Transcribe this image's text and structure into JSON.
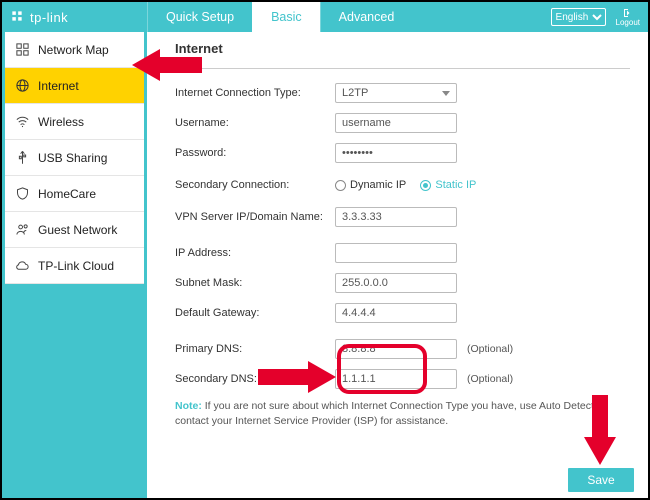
{
  "brand": "tp-link",
  "tabs": {
    "quick": "Quick Setup",
    "basic": "Basic",
    "advanced": "Advanced"
  },
  "lang": "English",
  "logout": "Logout",
  "sidebar": {
    "items": [
      {
        "label": "Network Map"
      },
      {
        "label": "Internet"
      },
      {
        "label": "Wireless"
      },
      {
        "label": "USB Sharing"
      },
      {
        "label": "HomeCare"
      },
      {
        "label": "Guest Network"
      },
      {
        "label": "TP-Link Cloud"
      }
    ]
  },
  "page": {
    "title": "Internet",
    "labels": {
      "conn_type": "Internet Connection Type:",
      "username": "Username:",
      "password": "Password:",
      "secondary": "Secondary Connection:",
      "vpn": "VPN Server IP/Domain Name:",
      "ip": "IP Address:",
      "subnet": "Subnet Mask:",
      "gateway": "Default Gateway:",
      "pdns": "Primary DNS:",
      "sdns": "Secondary DNS:"
    },
    "values": {
      "conn_type": "L2TP",
      "username": "username",
      "password": "••••••••",
      "dyn_ip": "Dynamic IP",
      "stat_ip": "Static IP",
      "vpn": "3.3.3.33",
      "ip": "",
      "subnet": "255.0.0.0",
      "gateway": "4.4.4.4",
      "pdns": "8.8.8.8",
      "sdns": "1.1.1.1"
    },
    "optional": "(Optional)",
    "note_label": "Note:",
    "note_text": "If you are not sure about which Internet Connection Type you have, use Auto Detect or contact your Internet Service Provider (ISP) for assistance.",
    "save": "Save"
  }
}
